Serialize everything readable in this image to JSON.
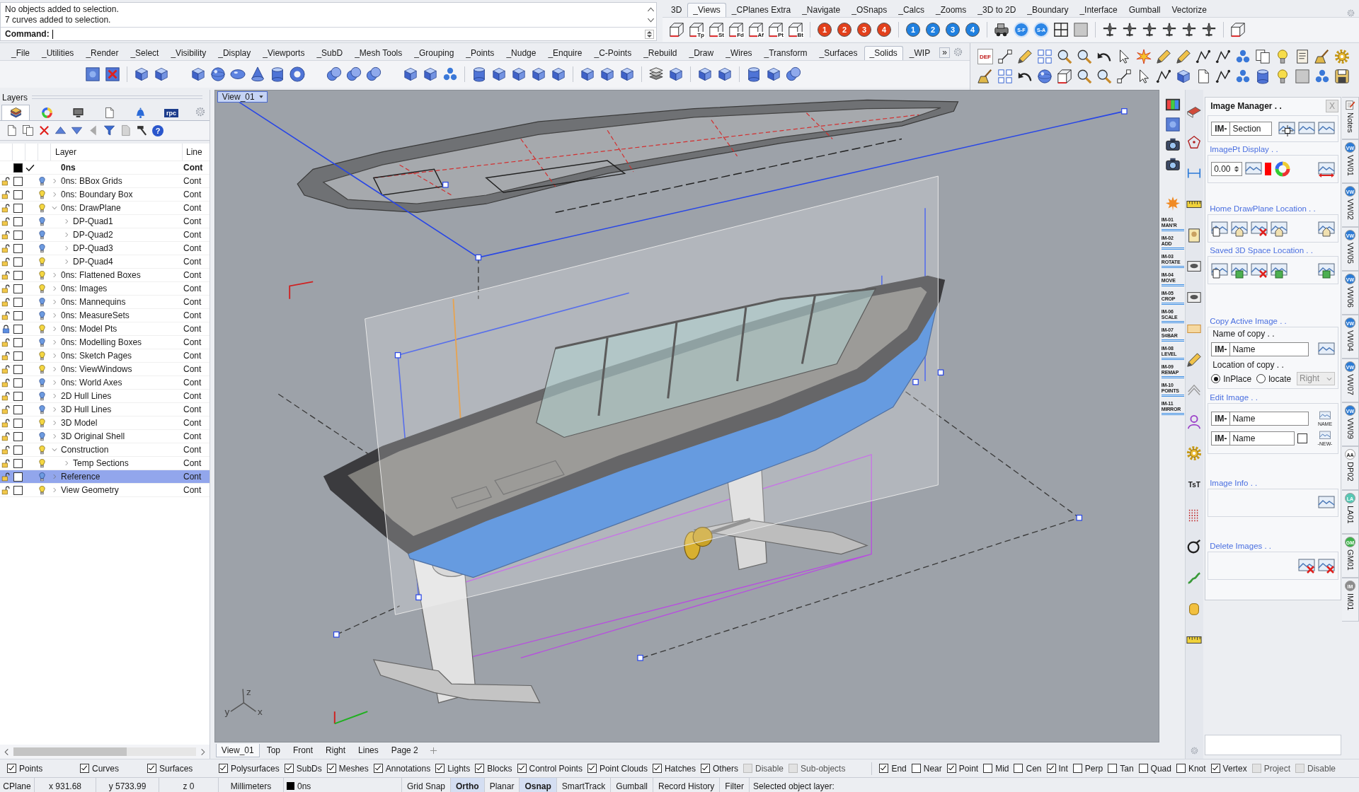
{
  "command_area": {
    "history": [
      "No objects added to selection.",
      "7 curves added to selection."
    ],
    "prompt": "Command:"
  },
  "top_tabs": [
    {
      "label": "3D",
      "selected": false
    },
    {
      "label": "_Views",
      "selected": true
    },
    {
      "label": "_CPlanes Extra",
      "selected": false
    },
    {
      "label": "_Navigate",
      "selected": false
    },
    {
      "label": "_OSnaps",
      "selected": false
    },
    {
      "label": "_Calcs",
      "selected": false
    },
    {
      "label": "_Zooms",
      "selected": false
    },
    {
      "label": "_3D to 2D",
      "selected": false
    },
    {
      "label": "_Boundary",
      "selected": false
    },
    {
      "label": "_Interface",
      "selected": false
    },
    {
      "label": "Gumball",
      "selected": false
    },
    {
      "label": "Vectorize",
      "selected": false
    }
  ],
  "top_toolbar": {
    "view_buttons": [
      "Tp",
      "St",
      "Fd",
      "Af",
      "Pt",
      "Bt"
    ],
    "numbered_buttons": [
      {
        "label": "1",
        "color": "#e2401c"
      },
      {
        "label": "2",
        "color": "#e2401c"
      },
      {
        "label": "3",
        "color": "#e2401c"
      },
      {
        "label": "4",
        "color": "#e2401c"
      },
      {
        "label": "1",
        "color": "#1f80e0"
      },
      {
        "label": "2",
        "color": "#1f80e0"
      },
      {
        "label": "3",
        "color": "#1f80e0"
      },
      {
        "label": "4",
        "color": "#1f80e0"
      }
    ],
    "snap_buttons": [
      "S-F",
      "S-A"
    ]
  },
  "main_tabs": [
    {
      "label": "_File",
      "selected": false
    },
    {
      "label": "_Utilities",
      "selected": false
    },
    {
      "label": "_Render",
      "selected": false
    },
    {
      "label": "_Select",
      "selected": false
    },
    {
      "label": "_Visibility",
      "selected": false
    },
    {
      "label": "_Display",
      "selected": false
    },
    {
      "label": "_Viewports",
      "selected": false
    },
    {
      "label": "_SubD",
      "selected": false
    },
    {
      "label": "_Mesh Tools",
      "selected": false
    },
    {
      "label": "_Grouping",
      "selected": false
    },
    {
      "label": "_Points",
      "selected": false
    },
    {
      "label": "_Nudge",
      "selected": false
    },
    {
      "label": "_Enquire",
      "selected": false
    },
    {
      "label": "_C-Points",
      "selected": false
    },
    {
      "label": "_Rebuild",
      "selected": false
    },
    {
      "label": "_Draw",
      "selected": false
    },
    {
      "label": "_Wires",
      "selected": false
    },
    {
      "label": "_Transform",
      "selected": false
    },
    {
      "label": "_Surfaces",
      "selected": false
    },
    {
      "label": "_Solids",
      "selected": true
    },
    {
      "label": "_WIP",
      "selected": false
    }
  ],
  "more_label": "»",
  "right_toolbar": {
    "def_label": "DEF"
  },
  "layers_panel": {
    "title": "Layers",
    "tabs": [
      {
        "kind": "layers",
        "selected": true
      },
      {
        "kind": "color-wheel",
        "selected": false
      },
      {
        "kind": "monitor",
        "selected": false
      },
      {
        "kind": "document",
        "selected": false
      },
      {
        "kind": "bell",
        "selected": false
      },
      {
        "kind": "rpc",
        "label": "rpc",
        "selected": false
      }
    ],
    "help_label": "?",
    "columns": [
      "Layer",
      "Line"
    ],
    "rows": [
      {
        "name": "0ns",
        "current": true,
        "color": "#000000",
        "linetype": "Cont",
        "selected": false
      },
      {
        "name": "0ns: BBox Grids",
        "locked": false,
        "color": "#ffffff",
        "current": false,
        "on": false,
        "expanded": false,
        "linetype": "Cont",
        "selected": false
      },
      {
        "name": "0ns: Boundary Box",
        "locked": false,
        "color": "#ffffff",
        "current": false,
        "on": true,
        "expanded": false,
        "linetype": "Cont",
        "selected": false
      },
      {
        "name": "0ns: DrawPlane",
        "locked": false,
        "color": "#ffffff",
        "current": false,
        "on": true,
        "expanded": true,
        "linetype": "Cont",
        "selected": false,
        "children": [
          {
            "name": "DP-Quad1",
            "locked": false,
            "color": "#ffffff",
            "current": false,
            "on": false,
            "expanded": false,
            "linetype": "Cont",
            "selected": false
          },
          {
            "name": "DP-Quad2",
            "locked": false,
            "color": "#ffffff",
            "current": false,
            "on": false,
            "expanded": false,
            "linetype": "Cont",
            "selected": false
          },
          {
            "name": "DP-Quad3",
            "locked": false,
            "color": "#ffffff",
            "current": false,
            "on": false,
            "expanded": false,
            "linetype": "Cont",
            "selected": false
          },
          {
            "name": "DP-Quad4",
            "locked": false,
            "color": "#ffffff",
            "current": false,
            "on": true,
            "expanded": false,
            "linetype": "Cont",
            "selected": false
          }
        ]
      },
      {
        "name": "0ns: Flattened Boxes",
        "locked": false,
        "color": "#ffffff",
        "current": false,
        "on": true,
        "expanded": false,
        "linetype": "Cont",
        "selected": false
      },
      {
        "name": "0ns: Images",
        "locked": false,
        "color": "#ffffff",
        "current": false,
        "on": true,
        "expanded": false,
        "linetype": "Cont",
        "selected": false
      },
      {
        "name": "0ns: Mannequins",
        "locked": false,
        "color": "#ffffff",
        "current": false,
        "on": false,
        "expanded": false,
        "linetype": "Cont",
        "selected": false
      },
      {
        "name": "0ns: MeasureSets",
        "locked": false,
        "color": "#ffffff",
        "current": false,
        "on": false,
        "expanded": false,
        "linetype": "Cont",
        "selected": false
      },
      {
        "name": "0ns: Model Pts",
        "locked": true,
        "color": "#ffffff",
        "current": false,
        "on": true,
        "expanded": false,
        "linetype": "Cont",
        "selected": false
      },
      {
        "name": "0ns: Modelling Boxes",
        "locked": false,
        "color": "#ffffff",
        "current": false,
        "on": false,
        "expanded": false,
        "linetype": "Cont",
        "selected": false
      },
      {
        "name": "0ns: Sketch Pages",
        "locked": false,
        "color": "#ffffff",
        "current": false,
        "on": true,
        "expanded": false,
        "linetype": "Cont",
        "selected": false
      },
      {
        "name": "0ns: ViewWindows",
        "locked": false,
        "color": "#ffffff",
        "current": false,
        "on": true,
        "expanded": false,
        "linetype": "Cont",
        "selected": false
      },
      {
        "name": "0ns: World Axes",
        "locked": false,
        "color": "#ffffff",
        "current": false,
        "on": false,
        "expanded": false,
        "linetype": "Cont",
        "selected": false
      },
      {
        "name": "2D Hull Lines",
        "locked": false,
        "color": "#ffffff",
        "current": false,
        "on": false,
        "expanded": false,
        "linetype": "Cont",
        "selected": false
      },
      {
        "name": "3D Hull Lines",
        "locked": false,
        "color": "#ffffff",
        "current": false,
        "on": false,
        "expanded": false,
        "linetype": "Cont",
        "selected": false
      },
      {
        "name": "3D Model",
        "locked": false,
        "color": "#ffffff",
        "current": false,
        "on": true,
        "expanded": false,
        "linetype": "Cont",
        "selected": false
      },
      {
        "name": "3D Original Shell",
        "locked": false,
        "color": "#ffffff",
        "current": false,
        "on": false,
        "expanded": false,
        "linetype": "Cont",
        "selected": false
      },
      {
        "name": "Construction",
        "locked": false,
        "color": "#ffffff",
        "current": false,
        "on": true,
        "expanded": true,
        "linetype": "Cont",
        "selected": false,
        "children": [
          {
            "name": "Temp Sections",
            "locked": false,
            "color": "#ffffff",
            "current": false,
            "on": true,
            "expanded": false,
            "linetype": "Cont",
            "selected": false
          }
        ]
      },
      {
        "name": "Reference",
        "locked": false,
        "color": "#ffffff",
        "current": false,
        "on": false,
        "expanded": false,
        "linetype": "Cont",
        "selected": true
      },
      {
        "name": "View Geometry",
        "locked": false,
        "color": "#ffffff",
        "current": false,
        "on": true,
        "expanded": false,
        "linetype": "Cont",
        "selected": false
      }
    ]
  },
  "viewport": {
    "title": "View_01",
    "axis_labels": [
      "z",
      "y",
      "x"
    ]
  },
  "view_tabs": [
    {
      "label": "View_01",
      "selected": true
    },
    {
      "label": "Top",
      "selected": false
    },
    {
      "label": "Front",
      "selected": false
    },
    {
      "label": "Right",
      "selected": false
    },
    {
      "label": "Lines",
      "selected": false
    },
    {
      "label": "Page 2",
      "selected": false
    }
  ],
  "side_toolbar": {
    "image_tools": [
      {
        "code": "IM-01",
        "action": "MAN'R"
      },
      {
        "code": "IM-02",
        "action": "ADD"
      },
      {
        "code": "IM-03",
        "action": "ROTATE"
      },
      {
        "code": "IM-04",
        "action": "MOVE"
      },
      {
        "code": "IM-05",
        "action": "CROP"
      },
      {
        "code": "IM-06",
        "action": "SCALE"
      },
      {
        "code": "IM-07",
        "action": "S¢BAR"
      },
      {
        "code": "IM-08",
        "action": "LEVEL"
      },
      {
        "code": "IM-09",
        "action": "REMAP"
      },
      {
        "code": "IM-10",
        "action": "POINTS"
      },
      {
        "code": "IM-11",
        "action": "MIRROR"
      }
    ],
    "text_tool_label": "TsT"
  },
  "image_manager": {
    "title": "Image Manager . .",
    "close_label": "X",
    "image_field": {
      "prefix": "IM-",
      "value": "Section"
    },
    "imagept_display": {
      "heading": "ImagePt Display . .",
      "value": "0.00",
      "color": "#ff0000"
    },
    "home_location": {
      "heading": "Home DrawPlane Location . ."
    },
    "saved_location": {
      "heading": "Saved 3D Space Location . ."
    },
    "copy_image": {
      "heading": "Copy Active Image . .",
      "name_label": "Name of copy . .",
      "name_field": {
        "prefix": "IM-",
        "value": "Name"
      },
      "location_label": "Location of copy . .",
      "options": [
        {
          "label": "InPlace",
          "selected": true
        },
        {
          "label": "locate",
          "selected": false
        }
      ],
      "side": {
        "value": "Right",
        "disabled": true
      }
    },
    "edit_image": {
      "heading": "Edit Image . .",
      "fields": [
        {
          "prefix": "IM-",
          "value": "Name",
          "button_label": "NAME"
        },
        {
          "prefix": "IM-",
          "value": "Name",
          "button_label": "-NEW-"
        }
      ],
      "new_option": {
        "checked": false
      }
    },
    "image_info": {
      "heading": "Image Info . ."
    },
    "delete_images": {
      "heading": "Delete Images . ."
    }
  },
  "side_tabs": [
    {
      "kind": "notes",
      "label": "Notes"
    },
    {
      "kind": "badge",
      "label": "VW01",
      "badge": "VW",
      "color": "#2b7bd6"
    },
    {
      "kind": "badge",
      "label": "VW02",
      "badge": "VW",
      "color": "#2b7bd6"
    },
    {
      "kind": "badge",
      "label": "VW05",
      "badge": "VW",
      "color": "#2b7bd6"
    },
    {
      "kind": "badge",
      "label": "VW06",
      "badge": "VW",
      "color": "#2b7bd6"
    },
    {
      "kind": "badge",
      "label": "VW04",
      "badge": "VW",
      "color": "#2b7bd6"
    },
    {
      "kind": "badge",
      "label": "VW07",
      "badge": "VW",
      "color": "#2b7bd6"
    },
    {
      "kind": "badge",
      "label": "VW09",
      "badge": "VW",
      "color": "#2b7bd6"
    },
    {
      "kind": "badge",
      "label": "DP02",
      "badge": "AA",
      "color": "#ffffff"
    },
    {
      "kind": "badge",
      "label": "LA01",
      "badge": "LA",
      "color": "#56c8b4"
    },
    {
      "kind": "badge",
      "label": "GM01",
      "badge": "GM",
      "color": "#3db24a"
    },
    {
      "kind": "badge",
      "label": "IM01",
      "badge": "IM",
      "color": "#8c8c8c"
    }
  ],
  "object_filters": [
    {
      "label": "Points",
      "checked": true,
      "disabled": false
    },
    {
      "label": "Curves",
      "checked": true,
      "disabled": false
    },
    {
      "label": "Surfaces",
      "checked": true,
      "disabled": false
    },
    {
      "label": "Polysurfaces",
      "checked": true,
      "disabled": false
    },
    {
      "label": "SubDs",
      "checked": true,
      "disabled": false
    },
    {
      "label": "Meshes",
      "checked": true,
      "disabled": false
    },
    {
      "label": "Annotations",
      "checked": true,
      "disabled": false
    },
    {
      "label": "Lights",
      "checked": true,
      "disabled": false
    },
    {
      "label": "Blocks",
      "checked": true,
      "disabled": false
    },
    {
      "label": "Control Points",
      "checked": true,
      "disabled": false
    },
    {
      "label": "Point Clouds",
      "checked": true,
      "disabled": false
    },
    {
      "label": "Hatches",
      "checked": true,
      "disabled": false
    },
    {
      "label": "Others",
      "checked": true,
      "disabled": false
    },
    {
      "label": "Disable",
      "checked": false,
      "disabled": true
    },
    {
      "label": "Sub-objects",
      "checked": false,
      "disabled": true
    }
  ],
  "osnaps": [
    {
      "label": "End",
      "checked": true,
      "disabled": false
    },
    {
      "label": "Near",
      "checked": false,
      "disabled": false
    },
    {
      "label": "Point",
      "checked": true,
      "disabled": false
    },
    {
      "label": "Mid",
      "checked": false,
      "disabled": false
    },
    {
      "label": "Cen",
      "checked": false,
      "disabled": false
    },
    {
      "label": "Int",
      "checked": true,
      "disabled": false
    },
    {
      "label": "Perp",
      "checked": false,
      "disabled": false
    },
    {
      "label": "Tan",
      "checked": false,
      "disabled": false
    },
    {
      "label": "Quad",
      "checked": false,
      "disabled": false
    },
    {
      "label": "Knot",
      "checked": false,
      "disabled": false
    },
    {
      "label": "Vertex",
      "checked": true,
      "disabled": false
    },
    {
      "label": "Project",
      "checked": false,
      "disabled": true
    },
    {
      "label": "Disable",
      "checked": false,
      "disabled": true
    }
  ],
  "status_bar": {
    "cplane": "CPlane",
    "x": "x 931.68",
    "y": "y 5733.99",
    "z": "z 0",
    "units": "Millimeters",
    "layer": {
      "name": "0ns",
      "color": "#000000"
    },
    "toggles": [
      {
        "label": "Grid Snap",
        "on": false
      },
      {
        "label": "Ortho",
        "on": true
      },
      {
        "label": "Planar",
        "on": false
      },
      {
        "label": "Osnap",
        "on": true
      },
      {
        "label": "SmartTrack",
        "on": false
      },
      {
        "label": "Gumball",
        "on": false
      },
      {
        "label": "Record History",
        "on": false
      },
      {
        "label": "Filter",
        "on": false
      }
    ],
    "message": "Selected object layer:"
  }
}
